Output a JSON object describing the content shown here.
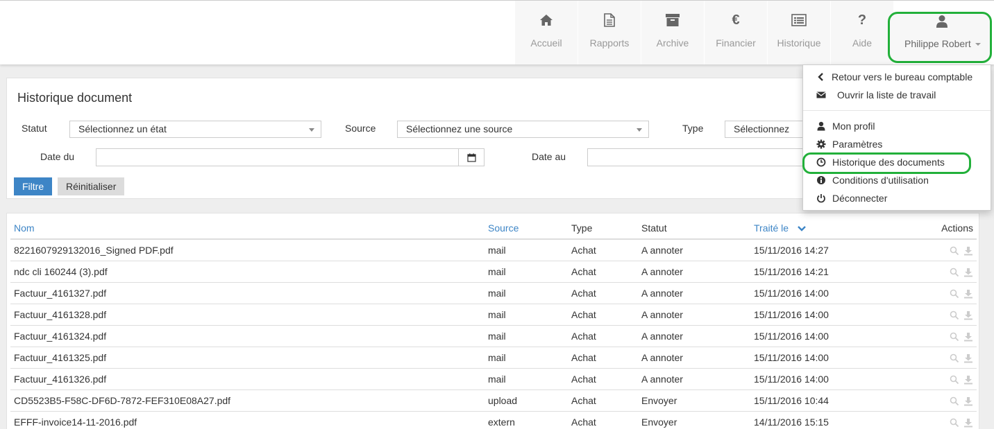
{
  "nav": {
    "items": [
      {
        "label": "Accueil",
        "icon": "home-icon"
      },
      {
        "label": "Rapports",
        "icon": "file-icon"
      },
      {
        "label": "Archive",
        "icon": "archive-icon"
      },
      {
        "label": "Financier",
        "icon": "euro-icon"
      },
      {
        "label": "Historique",
        "icon": "list-icon"
      },
      {
        "label": "Aide",
        "icon": "question-icon"
      }
    ],
    "euro_glyph": "€",
    "question_glyph": "?",
    "user": {
      "name": "Philippe Robert",
      "icon": "user-icon"
    },
    "highlight_color": "#22b03a"
  },
  "filter": {
    "title": "Historique document",
    "statut_label": "Statut",
    "statut_value": "Sélectionnez un état",
    "source_label": "Source",
    "source_value": "Sélectionnez une source",
    "type_label": "Type",
    "type_value": "Sélectionnez",
    "date_from_label": "Date du",
    "date_from_value": "",
    "date_to_label": "Date au",
    "date_to_value": "",
    "filter_button": "Filtre",
    "reset_button": "Réinitialiser"
  },
  "table": {
    "headers": {
      "name": "Nom",
      "source": "Source",
      "type": "Type",
      "status": "Statut",
      "processed": "Traité le",
      "actions": "Actions"
    },
    "rows": [
      {
        "name": "8221607929132016_Signed PDF.pdf",
        "source": "mail",
        "type": "Achat",
        "status": "A annoter",
        "date": "15/11/2016 14:27"
      },
      {
        "name": "ndc cli 160244 (3).pdf",
        "source": "mail",
        "type": "Achat",
        "status": "A annoter",
        "date": "15/11/2016 14:21"
      },
      {
        "name": "Factuur_4161327.pdf",
        "source": "mail",
        "type": "Achat",
        "status": "A annoter",
        "date": "15/11/2016 14:00"
      },
      {
        "name": "Factuur_4161328.pdf",
        "source": "mail",
        "type": "Achat",
        "status": "A annoter",
        "date": "15/11/2016 14:00"
      },
      {
        "name": "Factuur_4161324.pdf",
        "source": "mail",
        "type": "Achat",
        "status": "A annoter",
        "date": "15/11/2016 14:00"
      },
      {
        "name": "Factuur_4161325.pdf",
        "source": "mail",
        "type": "Achat",
        "status": "A annoter",
        "date": "15/11/2016 14:00"
      },
      {
        "name": "Factuur_4161326.pdf",
        "source": "mail",
        "type": "Achat",
        "status": "A annoter",
        "date": "15/11/2016 14:00"
      },
      {
        "name": "CD5523B5-F58C-DF6D-7872-FEF310E08A27.pdf",
        "source": "upload",
        "type": "Achat",
        "status": "Envoyer",
        "date": "15/11/2016 10:44"
      },
      {
        "name": "EFFF-invoice14-11-2016.pdf",
        "source": "extern",
        "type": "Achat",
        "status": "Envoyer",
        "date": "14/11/2016 15:15"
      }
    ]
  },
  "dropdown": {
    "items": [
      {
        "label": "Retour vers le bureau comptable",
        "icon": "chevron-left-icon"
      },
      {
        "label": "Ouvrir la liste de travail",
        "icon": "envelope-icon"
      },
      {
        "label": "Mon profil",
        "icon": "user-icon"
      },
      {
        "label": "Paramètres",
        "icon": "gear-icon"
      },
      {
        "label": "Historique des documents",
        "icon": "clock-icon"
      },
      {
        "label": "Conditions d'utilisation",
        "icon": "info-icon"
      },
      {
        "label": "Déconnecter",
        "icon": "power-icon"
      }
    ]
  }
}
